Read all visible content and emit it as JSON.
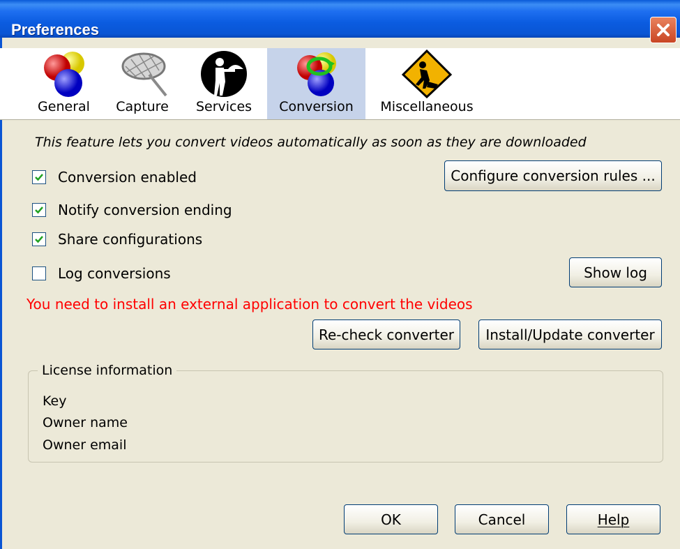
{
  "window": {
    "title": "Preferences"
  },
  "tabs": [
    {
      "label": "General",
      "icon": "colored-balls-icon"
    },
    {
      "label": "Capture",
      "icon": "net-icon"
    },
    {
      "label": "Services",
      "icon": "waiter-icon"
    },
    {
      "label": "Conversion",
      "icon": "conversion-balls-icon",
      "selected": true
    },
    {
      "label": "Miscellaneous",
      "icon": "roadwork-sign-icon"
    }
  ],
  "conversion": {
    "description": "This feature lets you convert videos automatically as soon as they are downloaded",
    "options": [
      {
        "label": "Conversion enabled",
        "checked": true
      },
      {
        "label": "Notify conversion ending",
        "checked": true
      },
      {
        "label": "Share configurations",
        "checked": true
      },
      {
        "label": "Log conversions",
        "checked": false
      }
    ],
    "configure_rules_label": "Configure conversion rules ...",
    "show_log_label": "Show log",
    "warning": "You need to install an external application to convert the videos",
    "recheck_label": "Re-check converter",
    "install_label": "Install/Update converter"
  },
  "license": {
    "title": "License information",
    "key_label": "Key",
    "owner_name_label": "Owner name",
    "owner_email_label": "Owner email"
  },
  "footer": {
    "ok_label": "OK",
    "cancel_label": "Cancel",
    "help_label": "Help"
  },
  "colors": {
    "titlebar": "#0a55d4",
    "selected_tab": "#c6d3ea",
    "warning": "#ff0000",
    "face": "#ece9d8"
  }
}
